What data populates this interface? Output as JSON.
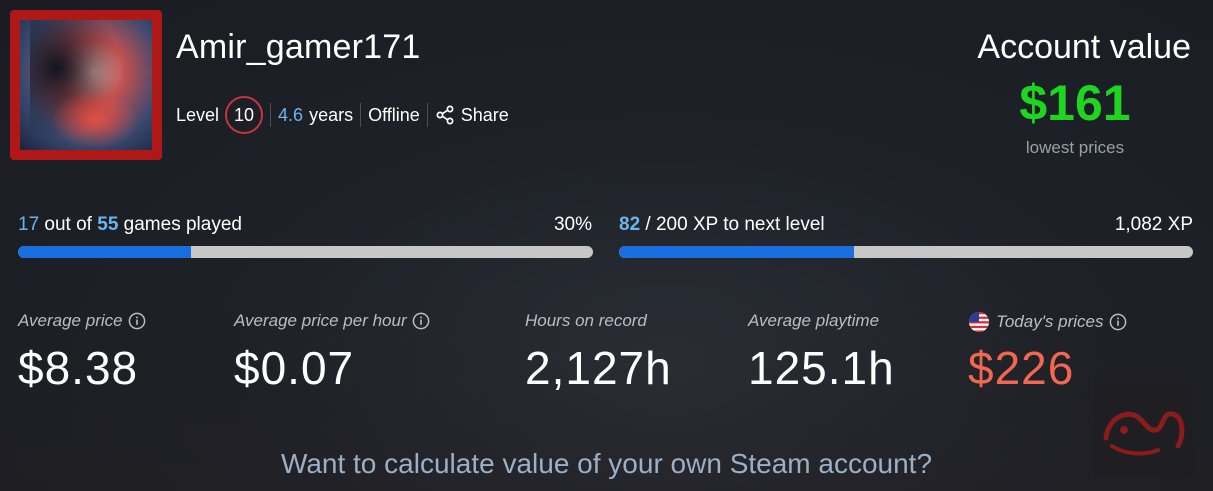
{
  "profile": {
    "username": "Amir_gamer171",
    "level_label": "Level",
    "level": "10",
    "years_num": "4.6",
    "years_unit": "years",
    "status": "Offline",
    "share_label": "Share"
  },
  "account_value": {
    "title": "Account value",
    "value": "$161",
    "subtitle": "lowest prices"
  },
  "games_progress": {
    "played": "17",
    "out_of_text": "out of",
    "total": "55",
    "suffix": "games played",
    "percent_text": "30%",
    "fraction": 0.3
  },
  "xp_progress": {
    "current": "82",
    "rest_text": "/ 200 XP to next level",
    "total_xp": "1,082 XP",
    "fraction": 0.41
  },
  "stats": [
    {
      "label": "Average price",
      "value": "$8.38"
    },
    {
      "label": "Average price per hour",
      "value": "$0.07"
    },
    {
      "label": "Hours on record",
      "value": "2,127h"
    },
    {
      "label": "Average playtime",
      "value": "125.1h"
    },
    {
      "label": "Today's prices",
      "value": "$226"
    }
  ],
  "cta": "Want to calculate value of your own Steam account?",
  "colors": {
    "accent_blue": "#1a6fe0",
    "link_blue": "#6cb4ee",
    "value_green": "#1fd61f",
    "price_red": "#f2674f",
    "level_ring": "#c9333b"
  }
}
